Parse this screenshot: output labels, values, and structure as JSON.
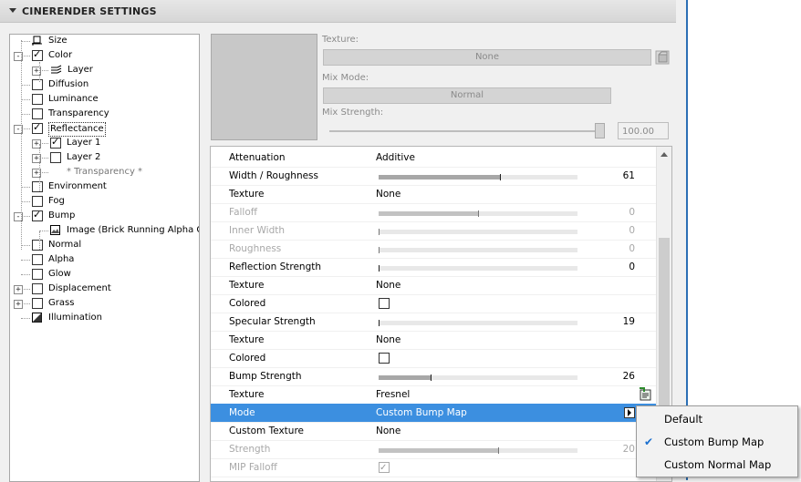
{
  "header": {
    "title": "CINERENDER SETTINGS"
  },
  "tree": {
    "items": [
      {
        "label": "Size",
        "checkbox": "none",
        "icon": "size-icon"
      },
      {
        "label": "Color",
        "checkbox": "checked",
        "expander": "-"
      },
      {
        "label": "Layer",
        "checkbox": "none",
        "icon": "layer-icon",
        "expander": "+"
      },
      {
        "label": "Diffusion",
        "checkbox": "unchecked"
      },
      {
        "label": "Luminance",
        "checkbox": "unchecked"
      },
      {
        "label": "Transparency",
        "checkbox": "unchecked"
      },
      {
        "label": "Reflectance",
        "checkbox": "checked",
        "expander": "-",
        "selected": true
      },
      {
        "label": "Layer 1",
        "checkbox": "checked",
        "expander": "+"
      },
      {
        "label": "Layer 2",
        "checkbox": "unchecked",
        "expander": "+"
      },
      {
        "label": "* Transparency *",
        "checkbox": "none",
        "expander": "+"
      },
      {
        "label": "Environment",
        "checkbox": "unchecked"
      },
      {
        "label": "Fog",
        "checkbox": "unchecked"
      },
      {
        "label": "Bump",
        "checkbox": "checked",
        "expander": "-"
      },
      {
        "label": "Image (Brick Running Alpha G:",
        "checkbox": "none",
        "icon": "image-icon"
      },
      {
        "label": "Normal",
        "checkbox": "unchecked"
      },
      {
        "label": "Alpha",
        "checkbox": "unchecked"
      },
      {
        "label": "Glow",
        "checkbox": "unchecked"
      },
      {
        "label": "Displacement",
        "checkbox": "unchecked",
        "expander": "+"
      },
      {
        "label": "Grass",
        "checkbox": "unchecked",
        "expander": "+"
      },
      {
        "label": "Illumination",
        "checkbox": "none",
        "icon": "illumination-icon"
      }
    ]
  },
  "texture_panel": {
    "texture_label": "Texture:",
    "texture_value": "None",
    "mix_mode_label": "Mix Mode:",
    "mix_mode_value": "Normal",
    "mix_strength_label": "Mix Strength:",
    "mix_strength_value": "100.00",
    "mix_strength_level": 1.0
  },
  "properties": [
    {
      "name": "Attenuation",
      "value": "Additive",
      "kind": "text"
    },
    {
      "name": "Width / Roughness",
      "kind": "slider",
      "num": "61",
      "level": 0.61
    },
    {
      "name": "Texture",
      "value": "None",
      "kind": "text"
    },
    {
      "name": "Falloff",
      "kind": "slider",
      "num": "0",
      "level": 0.5,
      "disabled": true
    },
    {
      "name": "Inner Width",
      "kind": "slider",
      "num": "0",
      "level": 0,
      "disabled": true
    },
    {
      "name": "Roughness",
      "kind": "slider",
      "num": "0",
      "level": 0,
      "disabled": true
    },
    {
      "name": "Reflection Strength",
      "kind": "slider",
      "num": "0",
      "level": 0
    },
    {
      "name": "Texture",
      "value": "None",
      "kind": "text"
    },
    {
      "name": "Colored",
      "kind": "checkbox"
    },
    {
      "name": "Specular Strength",
      "kind": "slider",
      "num": "19",
      "level": 0
    },
    {
      "name": "Texture",
      "value": "None",
      "kind": "text"
    },
    {
      "name": "Colored",
      "kind": "checkbox"
    },
    {
      "name": "Bump Strength",
      "kind": "slider",
      "num": "26",
      "level": 0.26
    },
    {
      "name": "Texture",
      "value": "Fresnel",
      "kind": "text",
      "icon": "texture-picker-icon"
    },
    {
      "name": "Mode",
      "value": "Custom Bump Map",
      "kind": "text",
      "selected": true
    },
    {
      "name": "Custom Texture",
      "value": "None",
      "kind": "text"
    },
    {
      "name": "Strength",
      "kind": "slider",
      "num": "20",
      "level": 0.6,
      "disabled": true
    },
    {
      "name": "MIP Falloff",
      "kind": "checkbox",
      "disabled": true,
      "checked": true
    }
  ],
  "mode_dropdown": {
    "options": [
      {
        "label": "Default",
        "checked": false
      },
      {
        "label": "Custom Bump Map",
        "checked": true
      },
      {
        "label": "Custom Normal Map",
        "checked": false
      }
    ]
  }
}
